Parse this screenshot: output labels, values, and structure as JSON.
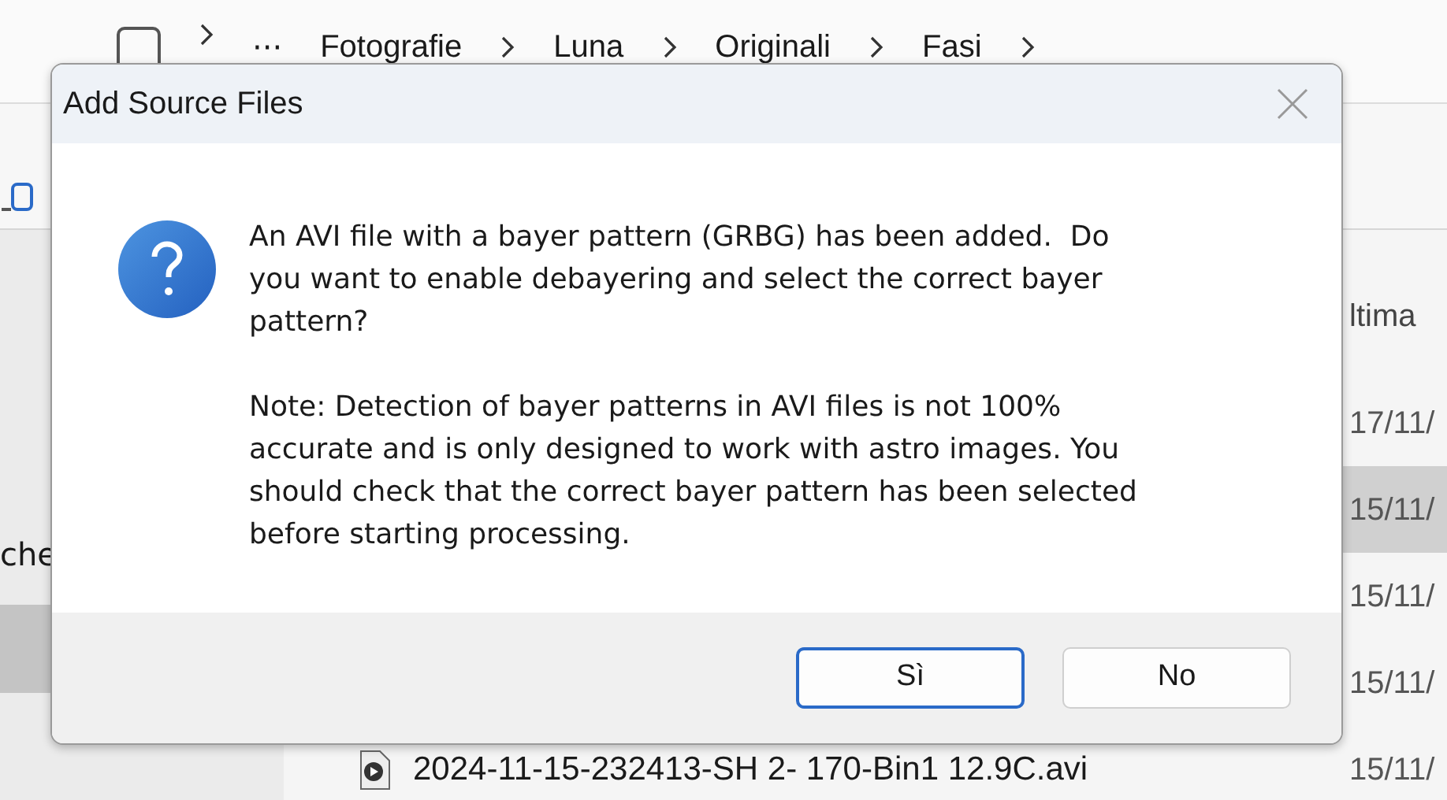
{
  "breadcrumb": {
    "more": "···",
    "items": [
      "Fotografie",
      "Luna",
      "Originali",
      "Fasi"
    ]
  },
  "sidebar": {
    "items": [
      {
        "label": "che",
        "selected": false
      },
      {
        "selected": true
      }
    ]
  },
  "files": {
    "column": "ltima",
    "rows": [
      {
        "date": "17/11/",
        "selected": false
      },
      {
        "date": "15/11/",
        "selected": true
      },
      {
        "date": "15/11/",
        "selected": false
      },
      {
        "date": "15/11/",
        "selected": false
      },
      {
        "name": "2024-11-15-232413-SH 2- 170-Bin1 12.9C.avi",
        "date": "15/11/",
        "selected": false
      }
    ]
  },
  "dialog": {
    "title": "Add Source Files",
    "message": [
      "An AVI file with a bayer pattern (GRBG) has been added.  Do you want to enable debayering and select the correct bayer pattern?",
      "Note: Detection of bayer patterns in AVI files is not 100% accurate and is only designed to work with astro images. You should check that the correct bayer pattern has been selected before starting processing."
    ],
    "buttons": [
      {
        "label": "Sì",
        "default": true
      },
      {
        "label": "No",
        "default": false
      }
    ]
  }
}
